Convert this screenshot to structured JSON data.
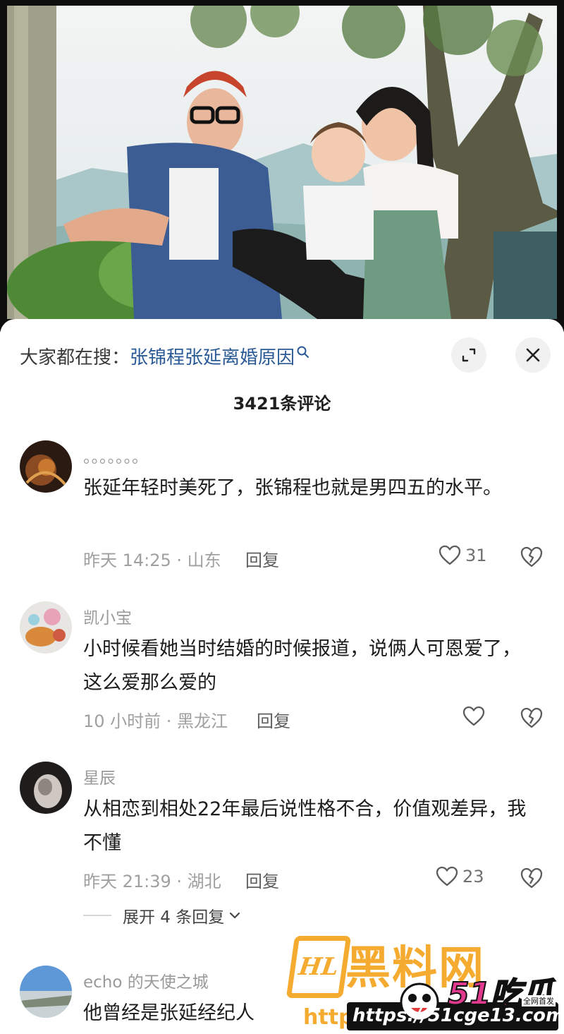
{
  "search": {
    "prefix": "大家都在搜：",
    "query": "张锦程张延离婚原因"
  },
  "comment_count": "3421条评论",
  "comments": [
    {
      "username": "。。。。。。。",
      "text": "张延年轻时美死了，张锦程也就是男四五的水平。",
      "meta": "昨天 14:25 · 山东",
      "reply": "回复",
      "likes": "31"
    },
    {
      "username": "凯小宝",
      "text": "小时候看她当时结婚的时候报道，说俩人可恩爱了，这么爱那么爱的",
      "meta": "10 小时前 · 黑龙江",
      "reply": "回复",
      "likes": ""
    },
    {
      "username": "星辰",
      "text": "从相恋到相处22年最后说性格不合，价值观差异，我不懂",
      "meta": "昨天 21:39 · 湖北",
      "reply": "回复",
      "likes": "23"
    },
    {
      "username": "echo 的天使之城",
      "text": "他曾经是张延经纪人",
      "meta": "",
      "reply": "",
      "likes": ""
    }
  ],
  "expand_replies": "展开 4 条回复",
  "watermark": {
    "logo": "HL",
    "site": "黑料网",
    "brand": "51吃瓜",
    "slogan": "全网首发",
    "http": "http",
    "url": "https://51cge13.com"
  },
  "icons": {
    "search": "search-icon",
    "expand": "expand-icon",
    "close": "close-icon",
    "like": "heart-icon",
    "dislike": "broken-heart-icon",
    "chevron": "chevron-down-icon"
  },
  "colors": {
    "link": "#2a5a96",
    "muted": "#a0a0a0",
    "watermark_orange": "#f4a21a",
    "watermark_pink": "#e03a8e"
  }
}
